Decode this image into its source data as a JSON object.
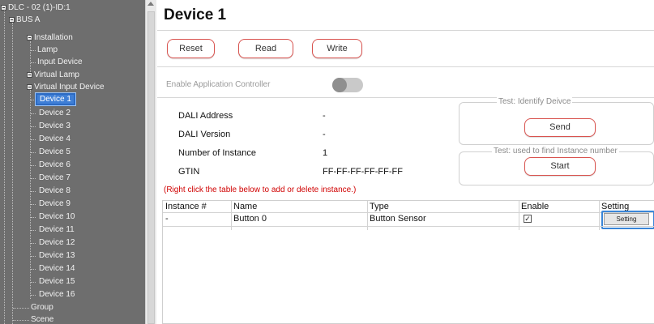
{
  "tree": {
    "root": "DLC - 02 (1)-ID:1",
    "bus": "BUS A",
    "installation": "Installation",
    "lamp": "Lamp",
    "input_device": "Input Device",
    "virtual_lamp": "Virtual Lamp",
    "virtual_input_device": "Virtual Input Device",
    "devices": [
      "Device 1",
      "Device 2",
      "Device 3",
      "Device 4",
      "Device 5",
      "Device 6",
      "Device 7",
      "Device 8",
      "Device 9",
      "Device 10",
      "Device 11",
      "Device 12",
      "Device 13",
      "Device 14",
      "Device 15",
      "Device 16"
    ],
    "selected_device": "Device 1",
    "group": "Group",
    "scene": "Scene"
  },
  "page": {
    "title": "Device 1"
  },
  "toolbar": {
    "reset_label": "Reset",
    "read_label": "Read",
    "write_label": "Write"
  },
  "app_controller": {
    "label": "Enable Application Controller",
    "enabled": false
  },
  "info": {
    "dali_address_label": "DALI Address",
    "dali_address_value": "-",
    "dali_version_label": "DALI Version",
    "dali_version_value": "-",
    "instances_label": "Number of Instance",
    "instances_value": "1",
    "gtin_label": "GTIN",
    "gtin_value": "FF-FF-FF-FF-FF-FF"
  },
  "tests": {
    "identify_legend": "Test: Identify Deivce",
    "identify_button": "Send",
    "instance_legend": "Test: used to find Instance number",
    "instance_button": "Start"
  },
  "note": "(Right click the table below to add or delete instance.)",
  "table": {
    "headers": [
      "Instance #",
      "Name",
      "Type",
      "Enable",
      "Setting"
    ],
    "rows": [
      {
        "instance": "-",
        "name": "Button 0",
        "type": "Button Sensor",
        "enable": true,
        "setting_label": "Setting"
      }
    ]
  },
  "colors": {
    "tree_bg": "#6e6e6e",
    "selection": "#3f7fd6",
    "button_border": "#d9534f",
    "note": "#d00000"
  }
}
